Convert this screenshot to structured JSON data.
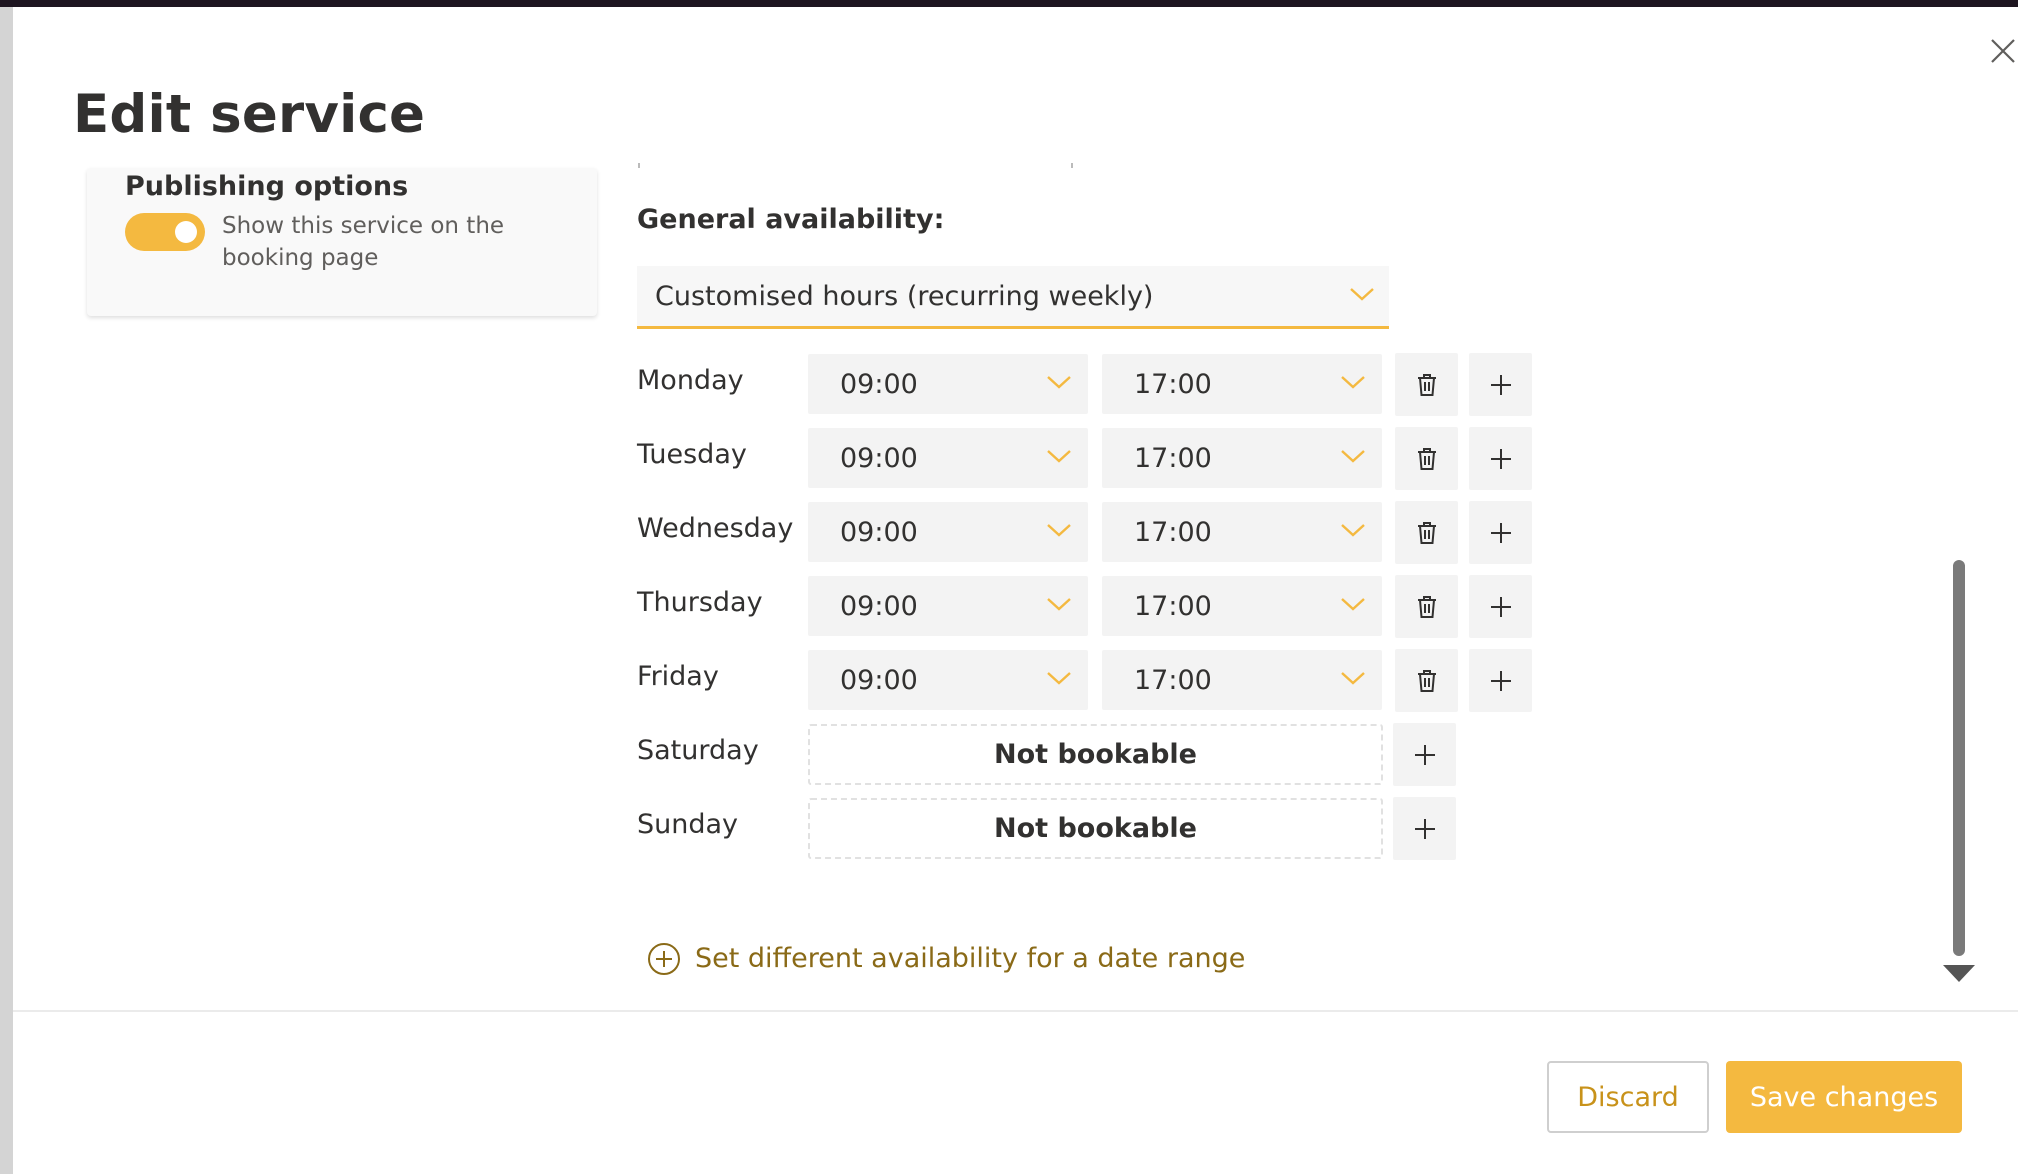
{
  "dialog": {
    "title": "Edit service",
    "close_icon": "close-icon"
  },
  "publishing": {
    "heading": "Publishing options",
    "toggle_label": "Show this service on the booking page",
    "toggle_on": true
  },
  "availability": {
    "label": "General availability:",
    "mode": "Customised hours (recurring weekly)",
    "days": [
      {
        "day": "Monday",
        "start": "09:00",
        "end": "17:00"
      },
      {
        "day": "Tuesday",
        "start": "09:00",
        "end": "17:00"
      },
      {
        "day": "Wednesday",
        "start": "09:00",
        "end": "17:00"
      },
      {
        "day": "Thursday",
        "start": "09:00",
        "end": "17:00"
      },
      {
        "day": "Friday",
        "start": "09:00",
        "end": "17:00"
      },
      {
        "day": "Saturday",
        "status": "Not bookable"
      },
      {
        "day": "Sunday",
        "status": "Not bookable"
      }
    ],
    "date_range_link": "Set different availability for a date range"
  },
  "footer": {
    "discard_label": "Discard",
    "save_label": "Save changes"
  },
  "colors": {
    "accent": "#f4b940",
    "link": "#8a6a17",
    "discard_text": "#c8921a"
  }
}
